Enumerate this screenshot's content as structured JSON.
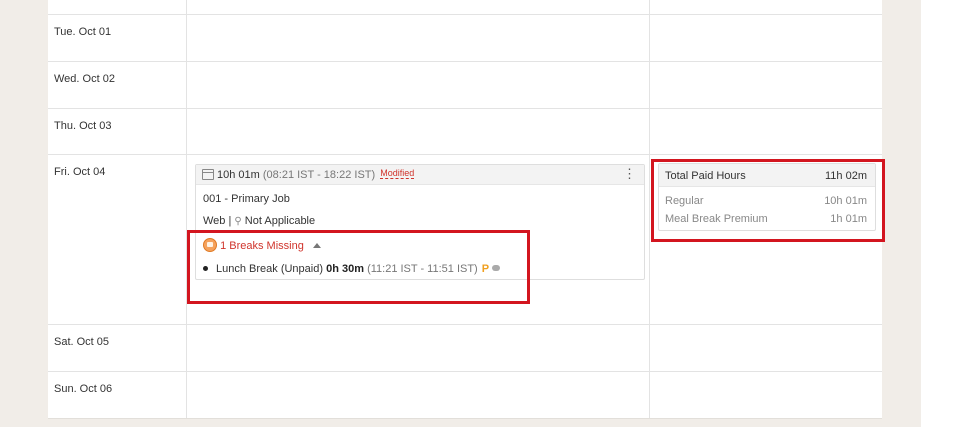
{
  "days": [
    {
      "label": "Tue. Oct 01"
    },
    {
      "label": "Wed. Oct 02"
    },
    {
      "label": "Thu. Oct 03"
    },
    {
      "label": "Fri. Oct 04"
    },
    {
      "label": "Sat. Oct 05"
    },
    {
      "label": "Sun. Oct 06"
    }
  ],
  "entry": {
    "duration": "10h 01m",
    "time_range": "(08:21 IST - 18:22 IST)",
    "modified": "Modified",
    "job": "001 - Primary Job",
    "source": "Web |",
    "location": "Not Applicable",
    "breaks_missing": "1 Breaks Missing",
    "break": {
      "name": "Lunch Break (Unpaid)",
      "duration": "0h 30m",
      "time_range": "(11:21 IST - 11:51 IST)",
      "p_badge": "P"
    }
  },
  "hours": {
    "total_label": "Total Paid Hours",
    "total_value": "11h 02m",
    "regular_label": "Regular",
    "regular_value": "10h 01m",
    "premium_label": "Meal Break Premium",
    "premium_value": "1h 01m"
  },
  "colors": {
    "highlight": "#d3151f",
    "missing_text": "#d0342c",
    "warning_icon": "#f5a25d"
  },
  "icons": [
    "calendar-icon",
    "kebab-menu-icon",
    "location-pin-icon",
    "break-warning-icon",
    "caret-up-icon",
    "premium-p-icon",
    "comment-icon"
  ]
}
